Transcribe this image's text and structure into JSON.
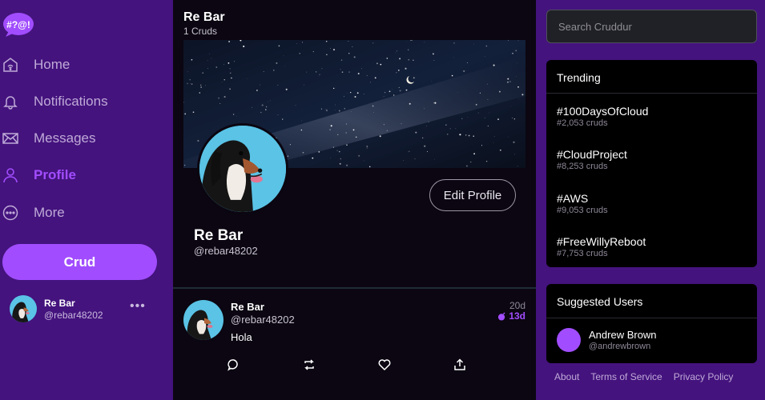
{
  "colors": {
    "sidebar": "#44137d",
    "accent": "#a14dff",
    "main_bg": "#0b0611"
  },
  "logo": {
    "text": "#?@!"
  },
  "nav": [
    {
      "label": "Home",
      "icon": "home-icon",
      "active": false
    },
    {
      "label": "Notifications",
      "icon": "bell-icon",
      "active": false
    },
    {
      "label": "Messages",
      "icon": "envelope-icon",
      "active": false
    },
    {
      "label": "Profile",
      "icon": "person-icon",
      "active": true
    },
    {
      "label": "More",
      "icon": "more-circle-icon",
      "active": false
    }
  ],
  "crud_button": "Crud",
  "current_user": {
    "name": "Re Bar",
    "handle": "@rebar48202",
    "menu": "•••"
  },
  "profile": {
    "title": "Re Bar",
    "count": "1 Cruds",
    "name": "Re Bar",
    "handle": "@rebar48202",
    "edit_label": "Edit Profile"
  },
  "posts": [
    {
      "name": "Re Bar",
      "handle": "@rebar48202",
      "text": "Hola",
      "time": "20d",
      "expires": "13d",
      "actions": [
        "reply-icon",
        "repost-icon",
        "like-icon",
        "share-icon"
      ]
    }
  ],
  "search": {
    "placeholder": "Search Cruddur"
  },
  "trending": {
    "title": "Trending",
    "items": [
      {
        "tag": "#100DaysOfCloud",
        "count": "#2,053 cruds"
      },
      {
        "tag": "#CloudProject",
        "count": "#8,253 cruds"
      },
      {
        "tag": "#AWS",
        "count": "#9,053 cruds"
      },
      {
        "tag": "#FreeWillyReboot",
        "count": "#7,753 cruds"
      }
    ]
  },
  "suggested": {
    "title": "Suggested Users",
    "users": [
      {
        "name": "Andrew Brown",
        "handle": "@andrewbrown"
      }
    ]
  },
  "footer": {
    "about": "About",
    "terms": "Terms of Service",
    "privacy": "Privacy Policy"
  }
}
